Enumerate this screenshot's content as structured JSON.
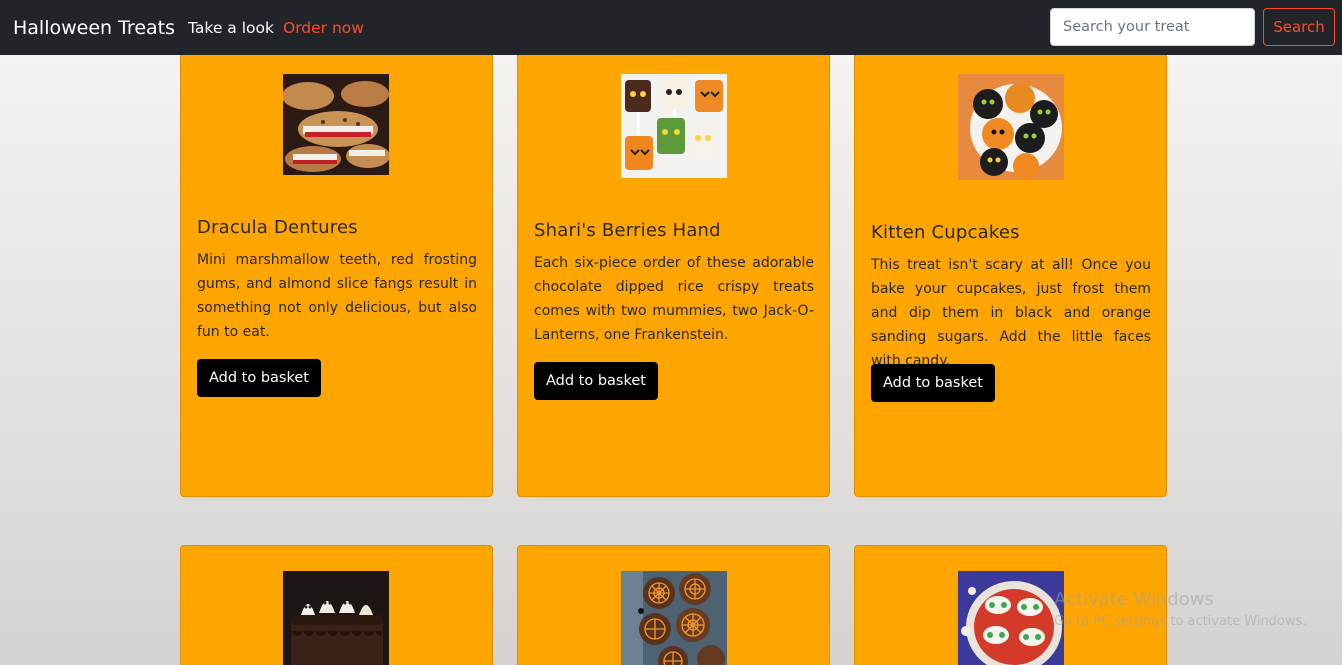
{
  "navbar": {
    "brand": "Halloween Treats",
    "links": [
      {
        "label": "Take a look"
      },
      {
        "label": "Order now",
        "color": "#fd4a2a"
      }
    ],
    "search": {
      "placeholder": "Search your treat",
      "button_label": "Search"
    }
  },
  "colors": {
    "navbar_bg": "#212529",
    "card_bg": "#ffa500",
    "accent": "#fd4a2a",
    "button_bg": "#000000"
  },
  "cards": [
    {
      "title": "Dracula Dentures",
      "text": "Mini marshmallow teeth, red frosting gums, and almond slice fangs result in something not only delicious, but also fun to eat.",
      "button_label": "Add to basket",
      "image": "dracula-dentures-cookies"
    },
    {
      "title": "Shari's Berries Hand",
      "text": "Each six-piece order of these adorable chocolate dipped rice crispy treats comes with two mummies, two Jack-O-Lanterns, one Frankenstein.",
      "button_label": "Add to basket",
      "image": "rice-crispy-monster-pops"
    },
    {
      "title": "Kitten Cupcakes",
      "text": "This treat isn't scary at all! Once you bake your cupcakes, just frost them and dip them in black and orange sanding sugars. Add the little faces with candy.",
      "button_label": "Add to basket",
      "image": "kitten-cupcakes-plate"
    },
    {
      "image": "chocolate-ghost-cake"
    },
    {
      "image": "spiderweb-cookies"
    },
    {
      "image": "monster-eye-platter"
    }
  ],
  "watermark": {
    "title": "Activate Windows",
    "subtitle": "Go to PC settings to activate Windows."
  }
}
